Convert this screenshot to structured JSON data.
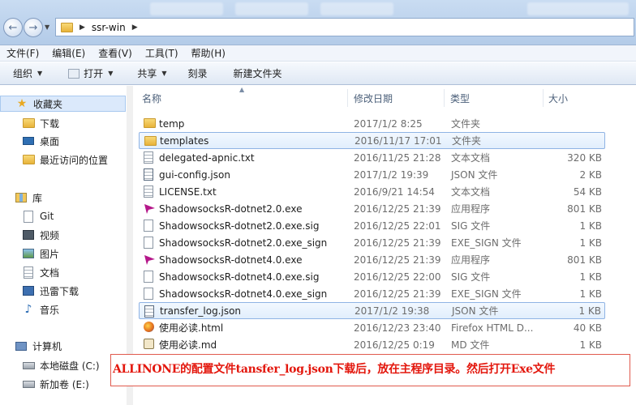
{
  "address": {
    "crumbs": [
      "ssr-win"
    ]
  },
  "menu": [
    "文件(F)",
    "编辑(E)",
    "查看(V)",
    "工具(T)",
    "帮助(H)"
  ],
  "toolbar": {
    "organize": "组织",
    "open": "打开",
    "share": "共享",
    "burn": "刻录",
    "new_folder": "新建文件夹"
  },
  "nav": {
    "favorites": "收藏夹",
    "downloads": "下载",
    "desktop": "桌面",
    "recent": "最近访问的位置",
    "libraries": "库",
    "git": "Git",
    "videos": "视频",
    "pictures": "图片",
    "documents": "文档",
    "thunder": "迅雷下载",
    "music": "音乐",
    "computer": "计算机",
    "local_disk": "本地磁盘 (C:)",
    "new_volume": "新加卷 (E:)"
  },
  "columns": {
    "name": "名称",
    "date": "修改日期",
    "type": "类型",
    "size": "大小"
  },
  "files": [
    {
      "name": "temp",
      "date": "2017/1/2 8:25",
      "type": "文件夹",
      "size": "",
      "icon": "folder"
    },
    {
      "name": "templates",
      "date": "2016/11/17 17:01",
      "type": "文件夹",
      "size": "",
      "icon": "folder"
    },
    {
      "name": "delegated-apnic.txt",
      "date": "2016/11/25 21:28",
      "type": "文本文档",
      "size": "320 KB",
      "icon": "text"
    },
    {
      "name": "gui-config.json",
      "date": "2017/1/2 19:39",
      "type": "JSON 文件",
      "size": "2 KB",
      "icon": "json"
    },
    {
      "name": "LICENSE.txt",
      "date": "2016/9/21 14:54",
      "type": "文本文档",
      "size": "54 KB",
      "icon": "text"
    },
    {
      "name": "ShadowsocksR-dotnet2.0.exe",
      "date": "2016/12/25 21:39",
      "type": "应用程序",
      "size": "801 KB",
      "icon": "exe"
    },
    {
      "name": "ShadowsocksR-dotnet2.0.exe.sig",
      "date": "2016/12/25 22:01",
      "type": "SIG 文件",
      "size": "1 KB",
      "icon": "blank"
    },
    {
      "name": "ShadowsocksR-dotnet2.0.exe_sign",
      "date": "2016/12/25 21:39",
      "type": "EXE_SIGN 文件",
      "size": "1 KB",
      "icon": "blank"
    },
    {
      "name": "ShadowsocksR-dotnet4.0.exe",
      "date": "2016/12/25 21:39",
      "type": "应用程序",
      "size": "801 KB",
      "icon": "exe"
    },
    {
      "name": "ShadowsocksR-dotnet4.0.exe.sig",
      "date": "2016/12/25 22:00",
      "type": "SIG 文件",
      "size": "1 KB",
      "icon": "blank"
    },
    {
      "name": "ShadowsocksR-dotnet4.0.exe_sign",
      "date": "2016/12/25 21:39",
      "type": "EXE_SIGN 文件",
      "size": "1 KB",
      "icon": "blank"
    },
    {
      "name": "transfer_log.json",
      "date": "2017/1/2 19:38",
      "type": "JSON 文件",
      "size": "1 KB",
      "icon": "json"
    },
    {
      "name": "使用必读.html",
      "date": "2016/12/23 23:40",
      "type": "Firefox HTML D...",
      "size": "40 KB",
      "icon": "html"
    },
    {
      "name": "使用必读.md",
      "date": "2016/12/25 0:19",
      "type": "MD 文件",
      "size": "1 KB",
      "icon": "md"
    }
  ],
  "annotation": "ALLINONE的配置文件tansfer_log.json下载后，放在主程序目录。然后打开Exe文件",
  "colors": {
    "annotation_red": "#e3170d",
    "selection_border": "#8fb3e4",
    "exe_magenta": "#b5178a"
  }
}
